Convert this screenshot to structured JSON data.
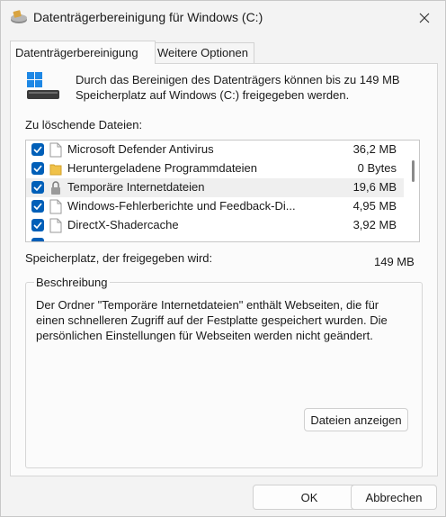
{
  "window": {
    "title": "Datenträgerbereinigung für Windows (C:)"
  },
  "tabs": [
    {
      "label": "Datenträgerbereinigung",
      "active": true
    },
    {
      "label": "Weitere Optionen",
      "active": false
    }
  ],
  "intro_text": "Durch das Bereinigen des Datenträgers können bis zu 149 MB Speicherplatz auf Windows (C:) freigegeben werden.",
  "files_label": "Zu löschende Dateien:",
  "files": [
    {
      "name": "Microsoft Defender Antivirus",
      "size": "36,2 MB",
      "checked": true,
      "icon": "file-icon"
    },
    {
      "name": "Heruntergeladene Programmdateien",
      "size": "0 Bytes",
      "checked": true,
      "icon": "folder-icon"
    },
    {
      "name": "Temporäre Internetdateien",
      "size": "19,6 MB",
      "checked": true,
      "icon": "lock-icon",
      "selected": true
    },
    {
      "name": "Windows-Fehlerberichte und Feedback-Di...",
      "size": "4,95 MB",
      "checked": true,
      "icon": "file-icon"
    },
    {
      "name": "DirectX-Shadercache",
      "size": "3,92 MB",
      "checked": true,
      "icon": "file-icon"
    }
  ],
  "space_label": "Speicherplatz, der freigegeben wird:",
  "space_value": "149 MB",
  "description": {
    "legend": "Beschreibung",
    "text": "Der Ordner \"Temporäre Internetdateien\" enthält Webseiten, die für einen schnelleren Zugriff auf der Festplatte gespeichert wurden. Die persönlichen Einstellungen für Webseiten werden nicht geändert."
  },
  "buttons": {
    "view_files": "Dateien anzeigen",
    "ok": "OK",
    "cancel": "Abbrechen"
  },
  "colors": {
    "checkbox": "#005fb8",
    "folder": "#f0c24a"
  }
}
